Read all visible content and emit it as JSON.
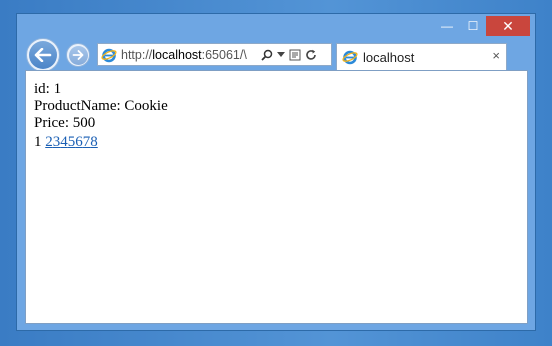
{
  "browser": {
    "address": {
      "prefix": "http://",
      "host": "localhost",
      "rest": ":65061/\\"
    },
    "tab": {
      "title": "localhost"
    },
    "caption": {
      "minimize_glyph": "—",
      "maximize_glyph": "☐",
      "close_glyph": "✕"
    },
    "tab_close_glyph": "×"
  },
  "page": {
    "lines": [
      "id: 1",
      "ProductName: Cookie",
      "Price: 500"
    ],
    "pager": {
      "current": "1",
      "links": [
        "2",
        "3",
        "4",
        "5",
        "6",
        "7",
        "8"
      ]
    }
  },
  "colors": {
    "desktop": "#3e82c9",
    "close_button": "#c9463d",
    "link": "#1a5fb4"
  },
  "icons": [
    "back-arrow-icon",
    "forward-arrow-icon",
    "ie-icon",
    "search-icon",
    "dropdown-icon",
    "compatibility-icon",
    "refresh-icon",
    "close-icon"
  ]
}
